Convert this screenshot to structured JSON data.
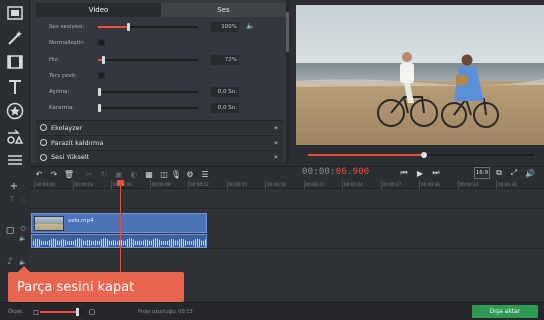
{
  "panel": {
    "tabs": [
      {
        "label": "Video",
        "active": true
      },
      {
        "label": "Ses",
        "active": false
      }
    ],
    "props": [
      {
        "label": "Ses seviyesi:",
        "kind": "slider",
        "fill": 0.3,
        "value": "100%",
        "speaker": true
      },
      {
        "label": "Normalleştir:",
        "kind": "check"
      },
      {
        "label": "Hız:",
        "kind": "slider",
        "fill": 0.05,
        "value": "72%"
      },
      {
        "label": "Ters çevir:",
        "kind": "check"
      },
      {
        "label": "Açılma:",
        "kind": "slider",
        "fill": 0.0,
        "value": "0,0 Sn."
      },
      {
        "label": "Kararma:",
        "kind": "slider",
        "fill": 0.0,
        "value": "0,0 Sn."
      }
    ],
    "sections": [
      "Ekolayzer",
      "Parazit kaldırma",
      "Sesi Yükselt"
    ]
  },
  "timecode": {
    "dim": "00:00:",
    "active": "06.900"
  },
  "ruler_ticks": [
    "00:00:00",
    "00:00:03",
    "00:00:06",
    "00:00:09",
    "00:00:12",
    "00:00:15",
    "00:00:18",
    "00:00:21",
    "00:00:24",
    "00:00:27",
    "00:00:30",
    "00:00:33",
    "00:00:36"
  ],
  "clip": {
    "name": "velo.mp4"
  },
  "tooltip": {
    "text": "Parça sesini kapat"
  },
  "status": {
    "zoom_label": "Ölçek:",
    "zoom_level": 0.85,
    "project_length": "Proje uzunluğu: 00:13",
    "export_label": "Dışa aktar"
  },
  "player": {
    "aspect": "16:9",
    "progress": 0.51
  },
  "colors": {
    "accent": "#e84c3d",
    "export": "#2e9a52",
    "clip": "#4a73b8",
    "tooltip": "#e8654f"
  }
}
